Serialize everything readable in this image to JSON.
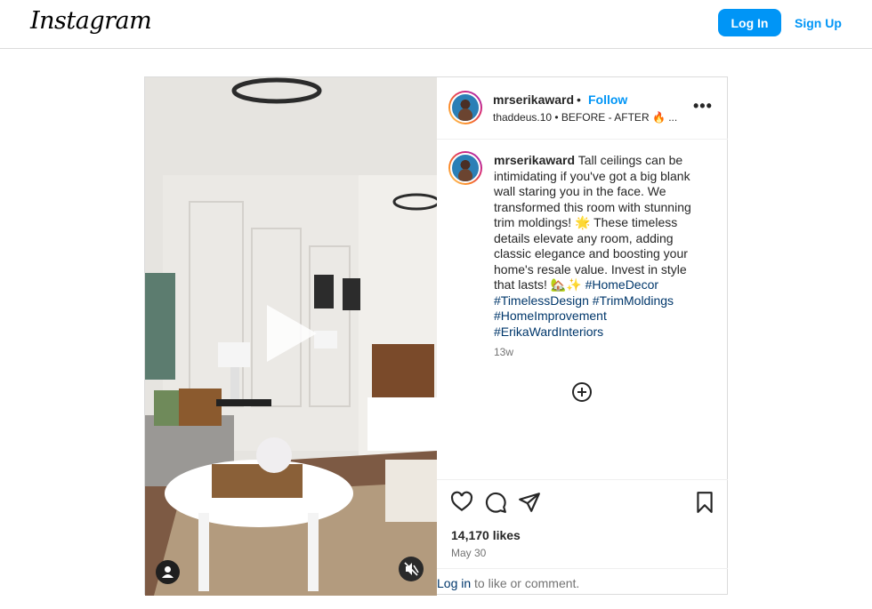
{
  "nav": {
    "logo": "Instagram",
    "login": "Log In",
    "signup": "Sign Up"
  },
  "post": {
    "username": "mrserikaward",
    "dot": "•",
    "follow": "Follow",
    "subline": "thaddeus.10 • BEFORE - AFTER 🔥 ...",
    "more": "•••",
    "caption_text": " Tall ceilings can be intimidating if you've got a big blank wall staring you in the face. We transformed this room with stunning trim moldings! 🌟 These timeless details elevate any room, adding classic elegance and boosting your home's resale value. Invest in style that lasts! 🏡✨ ",
    "hashtags": [
      "#HomeDecor",
      "#TimelessDesign",
      "#TrimMoldings",
      "#HomeImprovement",
      "#ErikaWardInteriors"
    ],
    "time": "13w",
    "likes": "14,170 likes",
    "date": "May 30",
    "login_link": "Log in",
    "login_text": " to like or comment."
  },
  "icons": {
    "like": "heart-icon",
    "comment": "comment-icon",
    "share": "share-icon",
    "save": "bookmark-icon",
    "plus": "plus-circle-icon",
    "play": "play-icon",
    "mute": "muted-speaker-icon",
    "user": "user-icon"
  },
  "colors": {
    "accent": "#0095f6",
    "link": "#00376b",
    "muted": "#737373"
  }
}
